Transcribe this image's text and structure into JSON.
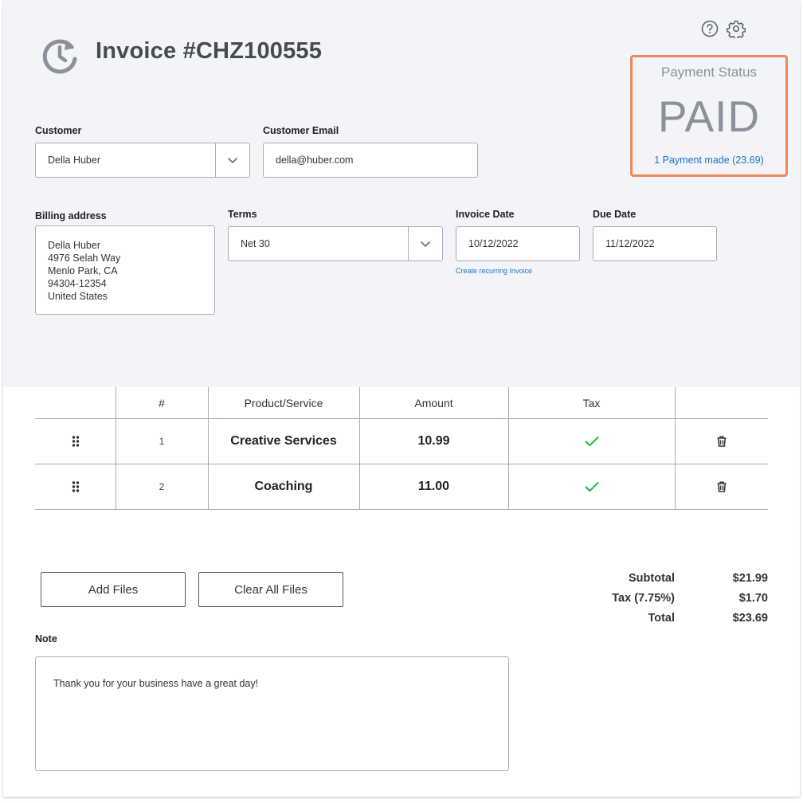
{
  "header": {
    "title": "Invoice #CHZ100555",
    "recurring_icon": "recurring-clock-icon",
    "help_icon": "help-icon",
    "settings_icon": "gear-icon"
  },
  "payment_status": {
    "label": "Payment Status",
    "value": "PAID",
    "link": "1 Payment made (23.69)",
    "border_color": "#f0875f",
    "link_color": "#1a73c8"
  },
  "customer": {
    "label": "Customer",
    "value": "Della Huber"
  },
  "customer_email": {
    "label": "Customer  Email",
    "value": "della@huber.com"
  },
  "billing": {
    "label": "Billing address",
    "lines": [
      "Della Huber",
      "4976 Selah Way",
      "Menlo Park, CA",
      "94304-12354",
      "United States"
    ]
  },
  "terms": {
    "label": "Terms",
    "value": "Net 30"
  },
  "invoice_date": {
    "label": "Invoice Date",
    "value": "10/12/2022",
    "recurring_link": "Create recurring Invoice"
  },
  "due_date": {
    "label": "Due Date",
    "value": "11/12/2022"
  },
  "table": {
    "headers": [
      "",
      "#",
      "Product/Service",
      "Amount",
      "Tax",
      ""
    ],
    "rows": [
      {
        "num": "1",
        "product": "Creative Services",
        "amount": "10.99",
        "tax": true
      },
      {
        "num": "2",
        "product": "Coaching",
        "amount": "11.00",
        "tax": true
      }
    ],
    "check_color": "#2cbe4e"
  },
  "files": {
    "add_label": "Add Files",
    "clear_label": "Clear All Files"
  },
  "totals": {
    "subtotal_label": "Subtotal",
    "subtotal_value": "$21.99",
    "tax_label": "Tax (7.75%)",
    "tax_value": "$1.70",
    "total_label": "Total",
    "total_value": "$23.69"
  },
  "note": {
    "label": "Note",
    "text": "Thank you for your business have a great day!"
  }
}
